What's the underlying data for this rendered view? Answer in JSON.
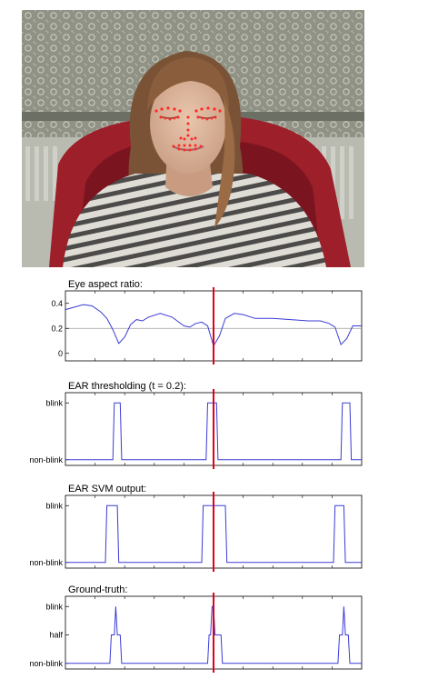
{
  "colors": {
    "signal": "#3b3bd6",
    "marker": "#e0001a",
    "threshold_line": "#9a9a9a",
    "landmark": "#ff2a2a"
  },
  "photo": {
    "icon": "face-photo-with-landmarks"
  },
  "chart_data": [
    {
      "type": "line",
      "title": "Eye aspect ratio:",
      "yticks": [
        {
          "v": 0.4,
          "label": "0.4"
        },
        {
          "v": 0.2,
          "label": "0.2"
        },
        {
          "v": 0,
          "label": "0"
        }
      ],
      "ylim": [
        -0.06,
        0.5
      ],
      "xlim": [
        0,
        100
      ],
      "threshold": 0.2,
      "marker_x": 50,
      "series": [
        {
          "x": [
            0,
            3,
            6,
            9,
            12,
            14,
            16,
            18,
            20,
            22,
            24,
            26,
            28,
            32,
            36,
            40,
            42,
            44,
            46,
            48,
            50,
            52,
            54,
            57,
            60,
            64,
            70,
            76,
            82,
            86,
            89,
            91,
            93,
            95,
            97,
            100
          ],
          "y": [
            0.35,
            0.37,
            0.39,
            0.38,
            0.33,
            0.28,
            0.19,
            0.08,
            0.13,
            0.23,
            0.27,
            0.26,
            0.29,
            0.32,
            0.29,
            0.22,
            0.21,
            0.24,
            0.25,
            0.22,
            0.06,
            0.14,
            0.28,
            0.32,
            0.31,
            0.28,
            0.28,
            0.27,
            0.26,
            0.26,
            0.24,
            0.21,
            0.07,
            0.12,
            0.22,
            0.22
          ]
        }
      ]
    },
    {
      "type": "line",
      "title": "EAR thresholding (t = 0.2):",
      "yticks": [
        {
          "v": 1,
          "label": "blink"
        },
        {
          "v": 0,
          "label": "non-blink"
        }
      ],
      "ylim": [
        -0.1,
        1.18
      ],
      "xlim": [
        0,
        100
      ],
      "marker_x": 50,
      "series": [
        {
          "x": [
            0,
            16,
            16.5,
            18.5,
            19,
            47.5,
            48,
            51,
            51.5,
            93,
            93.5,
            96,
            96.5,
            100
          ],
          "y": [
            0,
            0,
            1,
            1,
            0,
            0,
            1,
            1,
            0,
            0,
            1,
            1,
            0,
            0
          ]
        }
      ]
    },
    {
      "type": "line",
      "title": "EAR SVM output:",
      "yticks": [
        {
          "v": 1,
          "label": "blink"
        },
        {
          "v": 0,
          "label": "non-blink"
        }
      ],
      "ylim": [
        -0.1,
        1.18
      ],
      "xlim": [
        0,
        100
      ],
      "marker_x": 50,
      "series": [
        {
          "x": [
            0,
            13.5,
            14,
            17.5,
            18,
            46,
            46.5,
            54,
            54.5,
            90.5,
            91,
            94,
            94.5,
            100
          ],
          "y": [
            0,
            0,
            1,
            1,
            0,
            0,
            1,
            1,
            0,
            0,
            1,
            1,
            0,
            0
          ]
        }
      ]
    },
    {
      "type": "line",
      "title": "Ground-truth:",
      "yticks": [
        {
          "v": 1,
          "label": "blink"
        },
        {
          "v": 0.5,
          "label": "half"
        },
        {
          "v": 0,
          "label": "non-blink"
        }
      ],
      "ylim": [
        -0.1,
        1.18
      ],
      "xlim": [
        0,
        100
      ],
      "marker_x": 50,
      "series": [
        {
          "x": [
            0,
            15,
            15.5,
            16.5,
            17,
            17.5,
            18.5,
            19,
            48,
            48.5,
            49,
            49.5,
            50,
            50.5,
            51,
            51.5,
            52.5,
            53,
            92,
            92.5,
            93.5,
            94,
            94.5,
            95.5,
            96,
            100
          ],
          "y": [
            0,
            0,
            0.5,
            0.5,
            1,
            0.5,
            0.5,
            0,
            0,
            0.5,
            0.5,
            1,
            1,
            0.5,
            0.5,
            0.5,
            0.5,
            0,
            0,
            0.5,
            0.5,
            1,
            0.5,
            0.5,
            0,
            0
          ]
        }
      ]
    }
  ]
}
